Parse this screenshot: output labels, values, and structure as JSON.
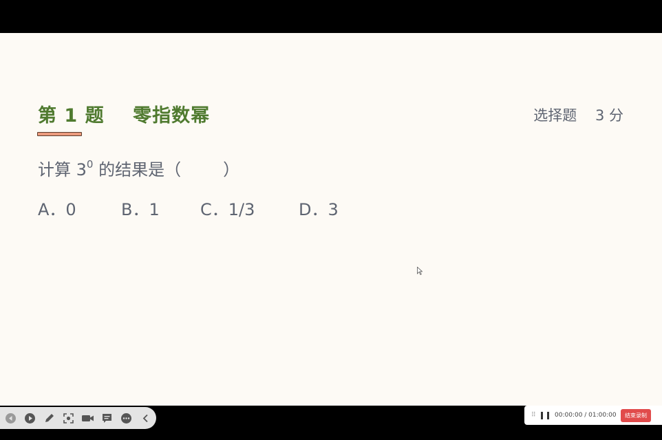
{
  "slide": {
    "title": "第 1 题    零指数幂",
    "meta": "选择题    3 分",
    "question_pre": "计算 3",
    "question_sup": "0",
    "question_post": " 的结果是（        ）",
    "options": [
      "A．0",
      "B．1",
      "C．1/3",
      "D．3"
    ],
    "accent_color": "#4f7a2f",
    "underline_color": "#ec9b7e"
  },
  "toolbar": {
    "icons": [
      "prev-icon",
      "play-icon",
      "pen-icon",
      "screenshot-icon",
      "camera-icon",
      "comment-icon",
      "more-icon",
      "collapse-icon"
    ]
  },
  "recorder": {
    "timer": "00:00:00 / 01:00:00",
    "stop_label": "结束录制"
  }
}
